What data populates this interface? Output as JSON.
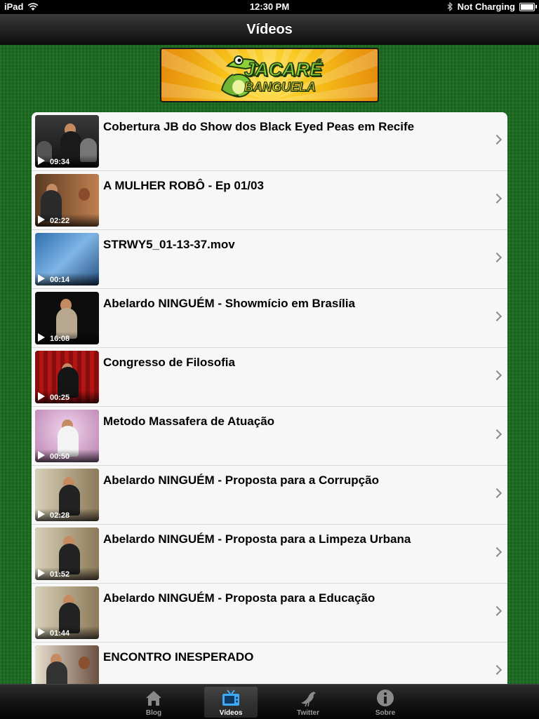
{
  "status_bar": {
    "device": "iPad",
    "time": "12:30 PM",
    "charge_status": "Not Charging"
  },
  "nav": {
    "title": "Vídeos"
  },
  "banner": {
    "brand_line1": "JACARÉ",
    "brand_line2": "BANGUELA"
  },
  "videos": [
    {
      "title": "Cobertura JB do Show dos Black Eyed Peas em Recife",
      "duration": "09:34"
    },
    {
      "title": "A MULHER ROBÔ - Ep 01/03",
      "duration": "02:22"
    },
    {
      "title": "STRWY5_01-13-37.mov",
      "duration": "00:14"
    },
    {
      "title": "Abelardo NINGUÉM - Showmício em Brasília",
      "duration": "16:08"
    },
    {
      "title": "Congresso de Filosofia",
      "duration": "00:25"
    },
    {
      "title": "Metodo Massafera de Atuação",
      "duration": "00:50"
    },
    {
      "title": "Abelardo NINGUÉM - Proposta para a Corrupção",
      "duration": "02:28"
    },
    {
      "title": "Abelardo NINGUÉM - Proposta para a Limpeza Urbana",
      "duration": "01:52"
    },
    {
      "title": "Abelardo NINGUÉM - Proposta para a Educação",
      "duration": "01:44"
    },
    {
      "title": "ENCONTRO INESPERADO",
      "duration": ""
    }
  ],
  "tabs": [
    {
      "label": "Blog",
      "icon": "home-icon",
      "active": false
    },
    {
      "label": "Vídeos",
      "icon": "tv-icon",
      "active": true
    },
    {
      "label": "Twitter",
      "icon": "bird-icon",
      "active": false
    },
    {
      "label": "Sobre",
      "icon": "info-icon",
      "active": false
    }
  ],
  "colors": {
    "felt_green": "#1b6a1f",
    "nav_dark": "#0d0d0d",
    "row_bg": "#f7f7f7"
  }
}
